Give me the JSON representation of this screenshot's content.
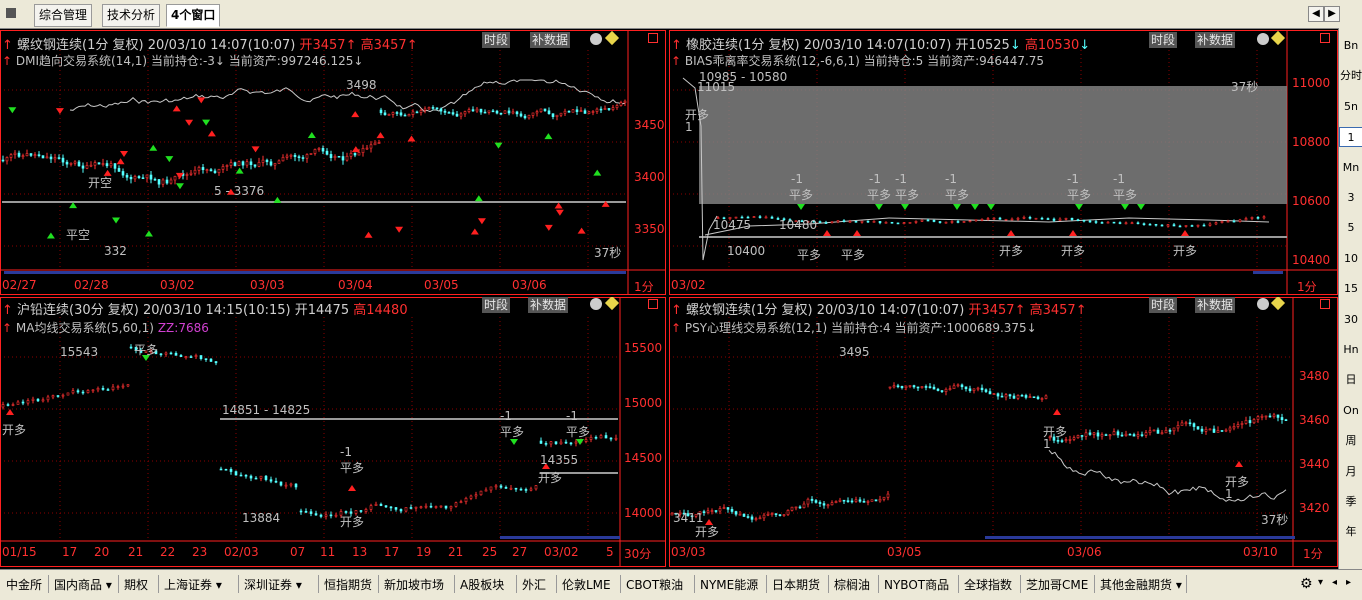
{
  "tabs": [
    {
      "label": "综合管理"
    },
    {
      "label": "技术分析"
    },
    {
      "label": "4个窗口"
    }
  ],
  "panels": {
    "tl": {
      "title_name": "螺纹钢连续(1分 复权) 20/03/10 14:07(10:07)",
      "open": "开3457",
      "high": "高3457",
      "indicator": "DMI趋向交易系统(14,1) 当前持仓:-3↓ 当前资产:997246.125↓",
      "buttons": [
        "时段",
        "补数据"
      ],
      "countdown": "37秒",
      "price_ticks": [
        "3450",
        "3400",
        "3350"
      ],
      "date_ticks": [
        "02/27",
        "02/28",
        "03/02",
        "03/03",
        "03/04",
        "03/05",
        "03/06"
      ],
      "period": "1分",
      "range_label": "5 - 3376",
      "markers": [
        "平空",
        "开空",
        "3",
        "332",
        "3498"
      ]
    },
    "tr": {
      "title_name": "橡胶连续(1分 复权) 20/03/10 14:07(10:07)",
      "open": "开10525",
      "high": "高10530",
      "indicator": "BIAS乖离率交易系统(12,-6,6,1) 当前持仓:5 当前资产:946447.75",
      "buttons": [
        "时段",
        "补数据"
      ],
      "countdown": "37秒",
      "price_ticks": [
        "11000",
        "10800",
        "10600",
        "10400"
      ],
      "date_ticks": [
        "03/02"
      ],
      "period": "1分",
      "range_label": "10985 - 10580",
      "markers": [
        "11015",
        "10475",
        "10400",
        "10480",
        "开多",
        "平多",
        "-1",
        "1"
      ]
    },
    "bl": {
      "title_name": "沪铅连续(30分 复权) 20/03/10 14:15(10:15)",
      "open": "开14475",
      "high": "高14480",
      "indicator": "MA均线交易系统(5,60,1)",
      "zz": "ZZ:7686",
      "buttons": [
        "时段",
        "补数据"
      ],
      "price_ticks": [
        "15500",
        "15000",
        "14500",
        "14000"
      ],
      "date_ticks": [
        "01/15",
        "17",
        "20",
        "21",
        "22",
        "23",
        "02/03",
        "07",
        "11",
        "13",
        "17",
        "19",
        "21",
        "25",
        "27",
        "03/02",
        "5"
      ],
      "period": "30分",
      "range_label": "14851 - 14825",
      "markers": [
        "15543",
        "13884",
        "14355",
        "开多",
        "平多",
        "-1",
        "1",
        "开多"
      ]
    },
    "br": {
      "title_name": "螺纹钢连续(1分 复权) 20/03/10 14:07(10:07)",
      "open": "开3457",
      "high": "高3457",
      "indicator": "PSY心理线交易系统(12,1) 当前持仓:4 当前资产:1000689.375↓",
      "buttons": [
        "时段",
        "补数据"
      ],
      "countdown": "37秒",
      "price_ticks": [
        "3480",
        "3460",
        "3440",
        "3420"
      ],
      "date_ticks": [
        "03/03",
        "03/05",
        "03/06",
        "03/10"
      ],
      "period": "1分",
      "markers": [
        "3495",
        "3411",
        "开多",
        "开多",
        "1",
        "开多"
      ]
    }
  },
  "right_toolbar": [
    "Bn",
    "分时",
    "5n",
    "1",
    "Mn",
    "3",
    "5",
    "10",
    "15",
    "30",
    "Hn",
    "日",
    "On",
    "周",
    "月",
    "季",
    "年"
  ],
  "bottom_tabs": [
    {
      "label": "中金所",
      "dropdown": false
    },
    {
      "label": "国内商品",
      "dropdown": true
    },
    {
      "label": "期权",
      "dropdown": false
    },
    {
      "label": "上海证券",
      "dropdown": true
    },
    {
      "label": "深圳证券",
      "dropdown": true
    },
    {
      "label": "恒指期货",
      "dropdown": false
    },
    {
      "label": "新加坡市场",
      "dropdown": false
    },
    {
      "label": "A股板块",
      "dropdown": false
    },
    {
      "label": "外汇",
      "dropdown": false
    },
    {
      "label": "伦敦LME",
      "dropdown": false
    },
    {
      "label": "CBOT粮油",
      "dropdown": false
    },
    {
      "label": "NYME能源",
      "dropdown": false
    },
    {
      "label": "日本期货",
      "dropdown": false
    },
    {
      "label": "棕榈油",
      "dropdown": false
    },
    {
      "label": "NYBOT商品",
      "dropdown": false
    },
    {
      "label": "全球指数",
      "dropdown": false
    },
    {
      "label": "芝加哥CME",
      "dropdown": false
    },
    {
      "label": "其他金融期货",
      "dropdown": true
    }
  ],
  "colors": {
    "up": "#ff3232",
    "down": "#54ffff",
    "grid": "#8b0000",
    "axis": "#ff2020",
    "white_line": "#c8c8c8"
  }
}
